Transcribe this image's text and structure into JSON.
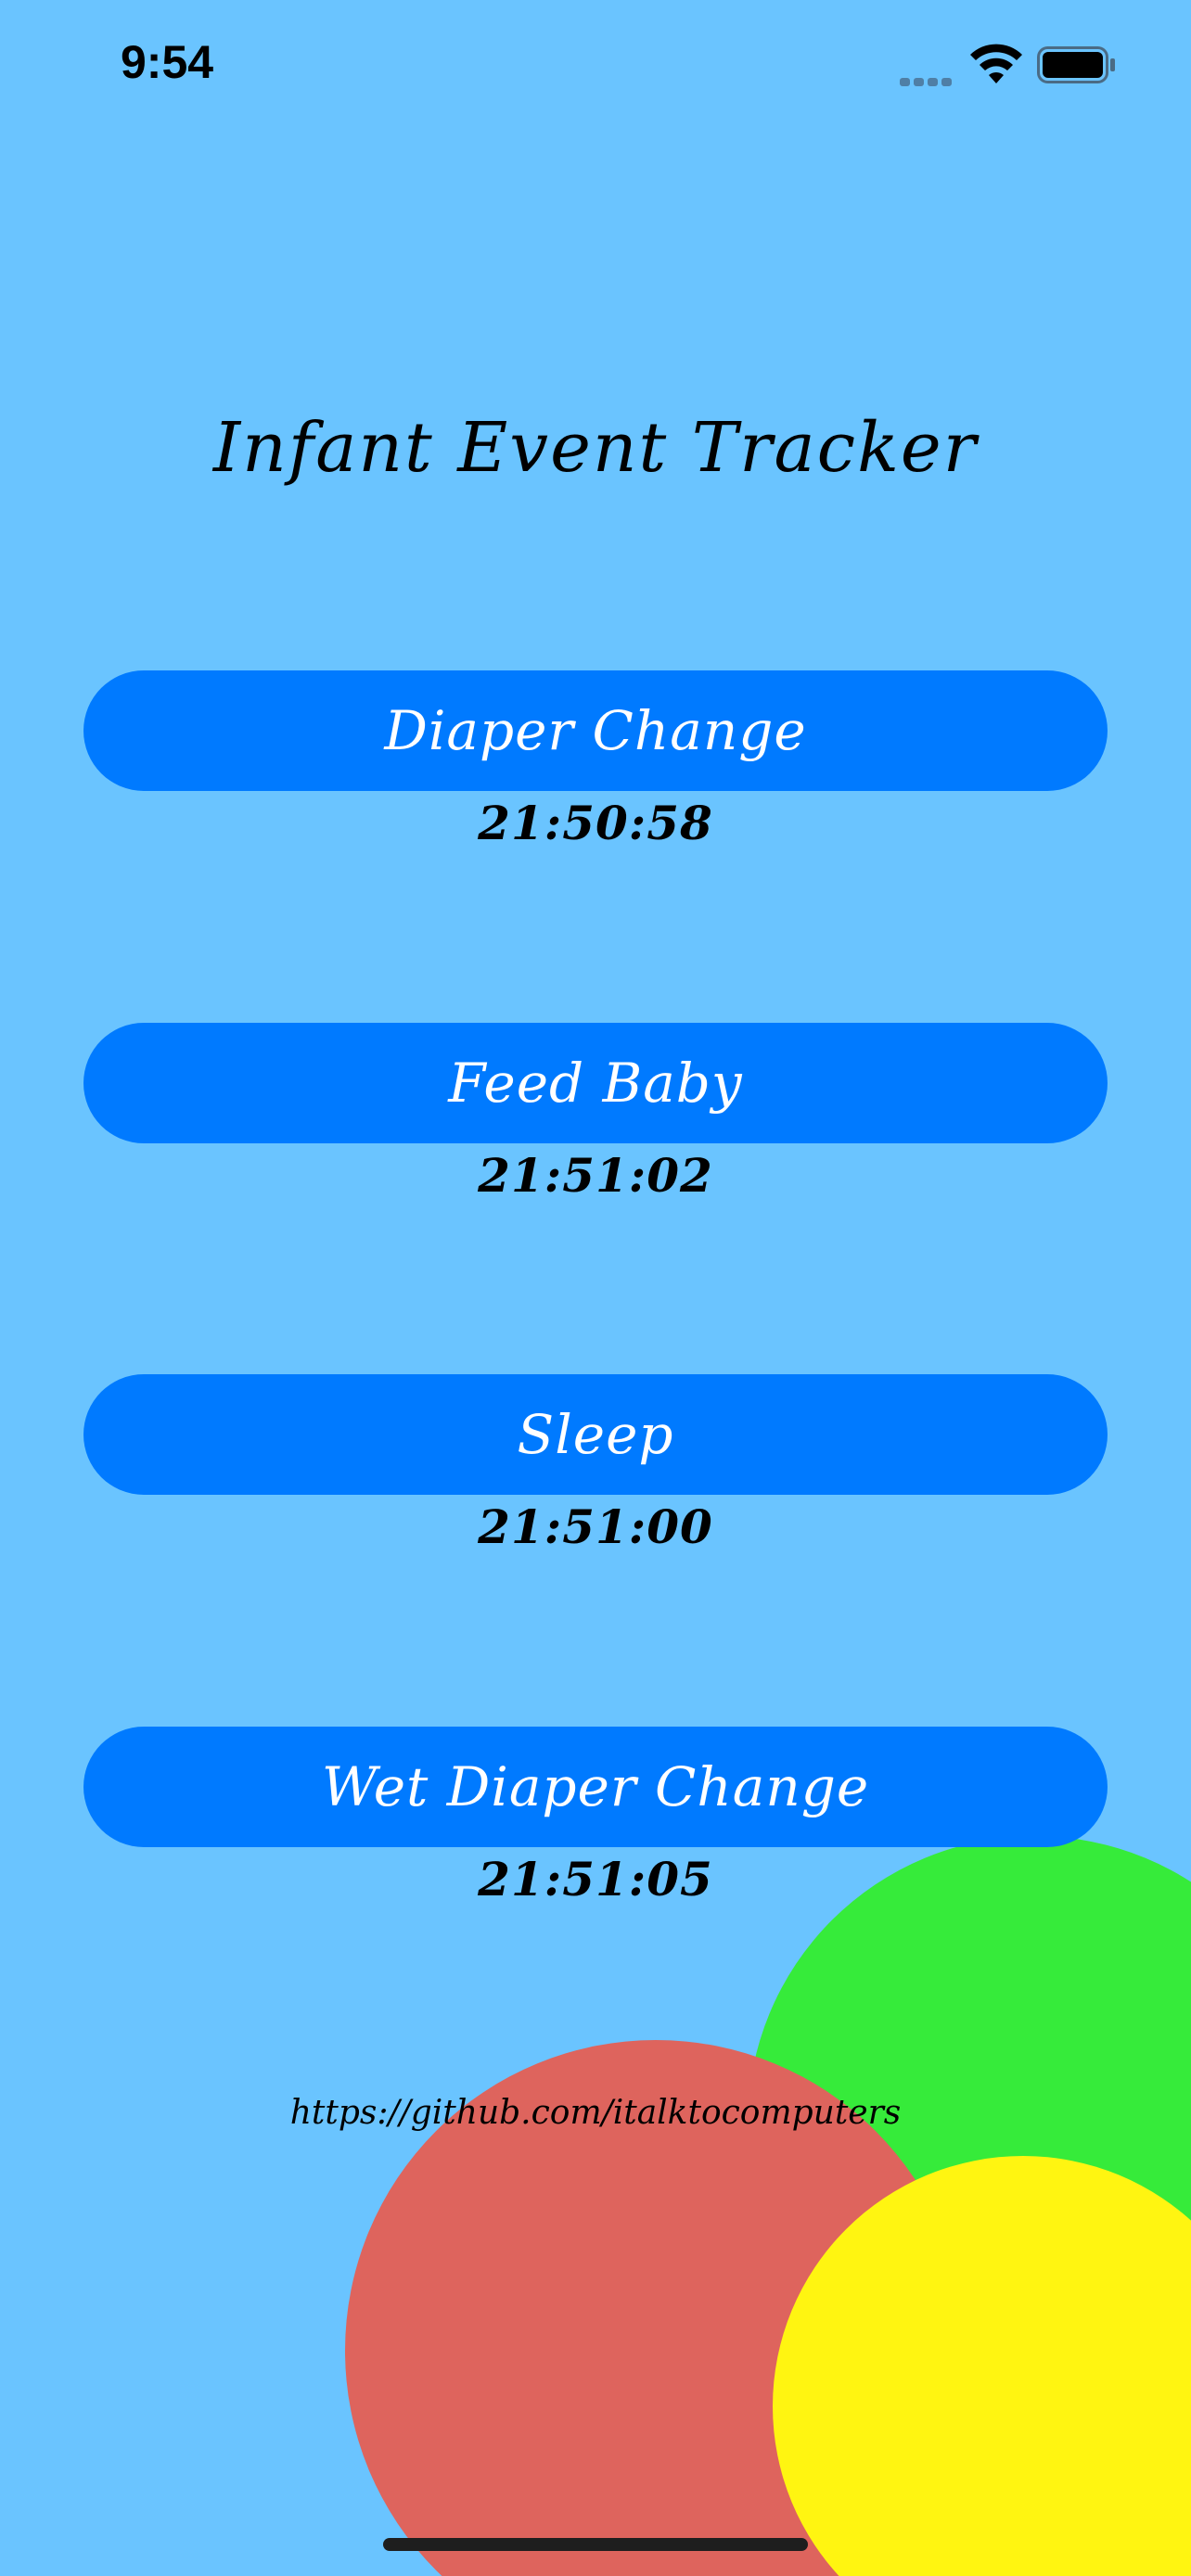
{
  "status_bar": {
    "time": "9:54"
  },
  "title": "Infant Event Tracker",
  "events": [
    {
      "label": "Diaper Change",
      "time": "21:50:58"
    },
    {
      "label": "Feed Baby",
      "time": "21:51:02"
    },
    {
      "label": "Sleep",
      "time": "21:51:00"
    },
    {
      "label": "Wet Diaper Change",
      "time": "21:51:05"
    }
  ],
  "footer": {
    "link": "https://github.com/italktocomputers"
  },
  "colors": {
    "background": "#6AC4FF",
    "button": "#007AFF",
    "circle_green": "#36EB3A",
    "circle_red": "#DE645D",
    "circle_yellow": "#FFF511"
  }
}
